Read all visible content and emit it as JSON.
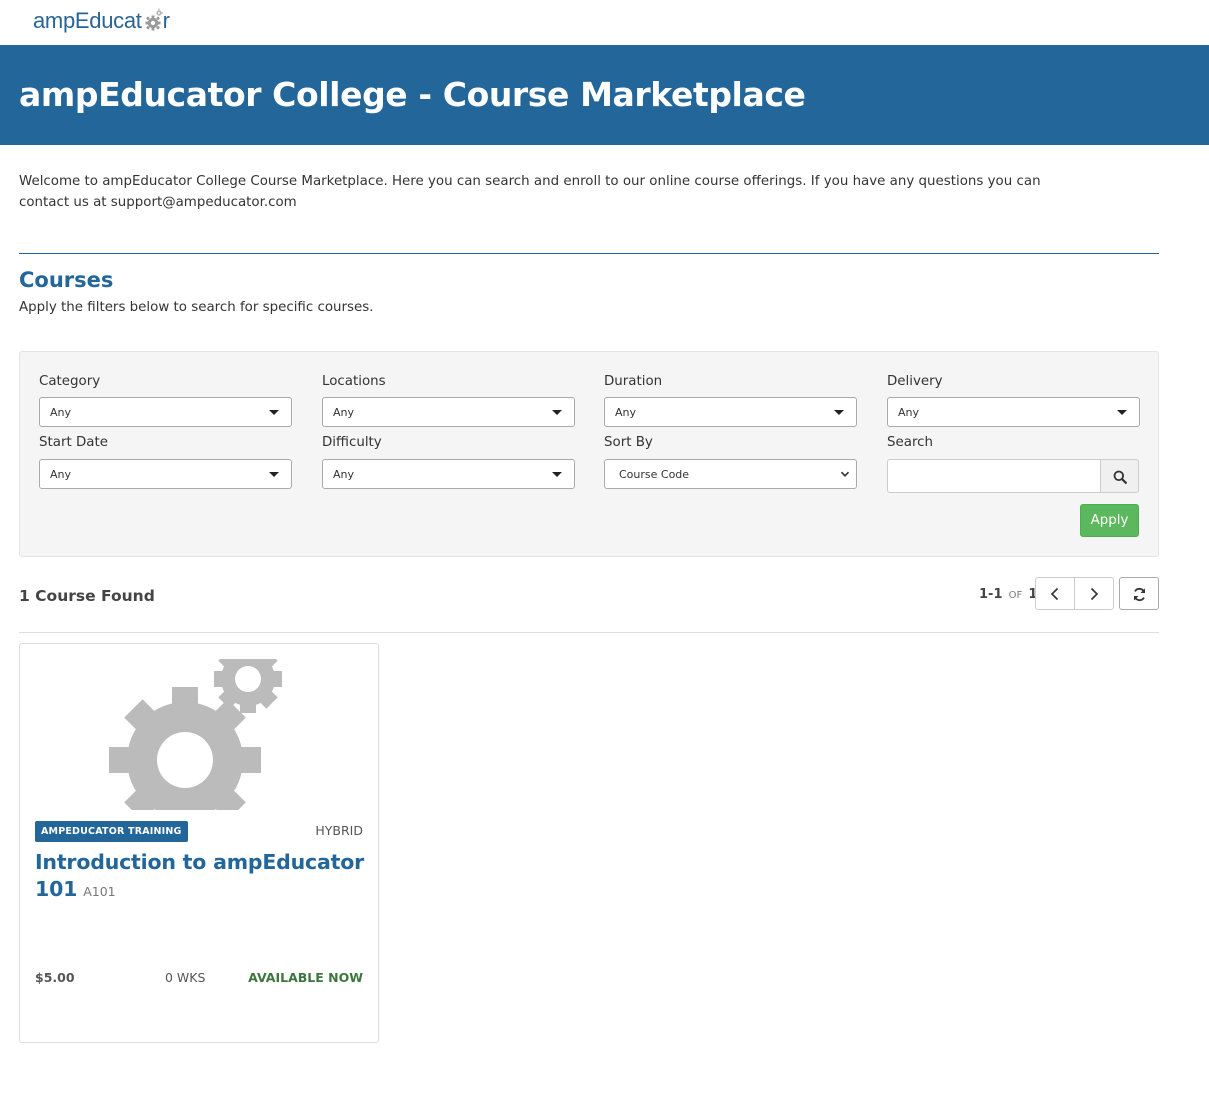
{
  "logo": {
    "text_before": "ampEducat",
    "text_after": "r"
  },
  "banner": {
    "title": "ampEducator College - Course Marketplace"
  },
  "welcome": {
    "text": "Welcome to ampEducator College Course Marketplace. Here you can search and enroll to our online course offerings. If you have any questions you can contact us at support@ampeducator.com"
  },
  "courses": {
    "title": "Courses",
    "subtitle": "Apply the filters below to search for specific courses."
  },
  "filters": {
    "category": {
      "label": "Category",
      "value": "Any"
    },
    "locations": {
      "label": "Locations",
      "value": "Any"
    },
    "duration": {
      "label": "Duration",
      "value": "Any"
    },
    "delivery": {
      "label": "Delivery",
      "value": "Any"
    },
    "start_date": {
      "label": "Start Date",
      "value": "Any"
    },
    "difficulty": {
      "label": "Difficulty",
      "value": "Any"
    },
    "sort_by": {
      "label": "Sort By",
      "value": "Course Code"
    },
    "search": {
      "label": "Search",
      "value": "",
      "placeholder": ""
    },
    "apply_label": "Apply"
  },
  "results": {
    "found_text": "1 Course Found",
    "range": "1-1",
    "of_label": "of",
    "total": "1"
  },
  "course_card": {
    "category_badge": "AMPEDUCATOR TRAINING",
    "delivery": "HYBRID",
    "title": "Introduction to ampEducator 101",
    "code": "A101",
    "price": "$5.00",
    "duration": "0 WKS",
    "availability": "AVAILABLE NOW"
  },
  "colors": {
    "brand_blue": "#236699",
    "apply_green": "#5cb85c",
    "available_green": "#3c763d",
    "gear_gray": "#bbbbbb"
  },
  "icons": {
    "logo_gear": "gear-icon",
    "select_caret": "caret-down-icon",
    "search": "search-icon",
    "previous": "chevron-left-icon",
    "next": "chevron-right-icon",
    "refresh": "refresh-icon",
    "course_image": "gears-icon"
  }
}
